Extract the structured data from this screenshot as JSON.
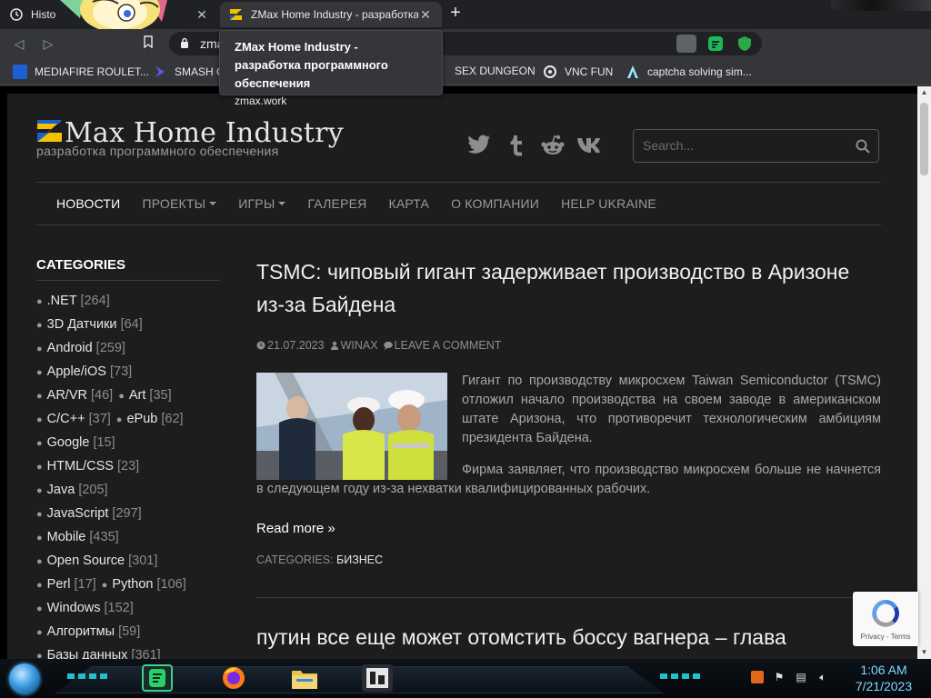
{
  "browser": {
    "tabs": [
      {
        "label": "Histo",
        "active": false
      },
      {
        "label": "ZMax Home Industry - разработка",
        "active": true
      }
    ],
    "address": {
      "value": "zma"
    },
    "bookmarks": [
      {
        "label": "MEDIAFIRE ROULET..."
      },
      {
        "label": "SMASH G"
      },
      {
        "label": "SEX DUNGEON"
      },
      {
        "label": "VNC FUN"
      },
      {
        "label": "captcha solving sim..."
      }
    ],
    "tooltip": {
      "title": "ZMax Home Industry - разработка программного обеспечения",
      "url": "zmax.work"
    }
  },
  "site": {
    "logo_title": "Max Home Industry",
    "logo_subtitle": "разработка программного обеспечения",
    "search_placeholder": "Search...",
    "nav": [
      {
        "label": "Новости",
        "active": true,
        "dropdown": false
      },
      {
        "label": "Проекты",
        "active": false,
        "dropdown": true
      },
      {
        "label": "Игры",
        "active": false,
        "dropdown": true
      },
      {
        "label": "Галерея",
        "active": false,
        "dropdown": false
      },
      {
        "label": "Карта",
        "active": false,
        "dropdown": false
      },
      {
        "label": "О компании",
        "active": false,
        "dropdown": false
      },
      {
        "label": "Help Ukraine",
        "active": false,
        "dropdown": false
      }
    ],
    "social_icons": [
      "twitter-icon",
      "tumblr-icon",
      "reddit-icon",
      "vk-icon"
    ],
    "categories_heading": "CATEGORIES",
    "categories": [
      [
        {
          "name": ".NET",
          "count": "[264]"
        }
      ],
      [
        {
          "name": "3D Датчики",
          "count": "[64]"
        }
      ],
      [
        {
          "name": "Android",
          "count": "[259]"
        }
      ],
      [
        {
          "name": "Apple/iOS",
          "count": "[73]"
        }
      ],
      [
        {
          "name": "AR/VR",
          "count": "[46]"
        },
        {
          "name": "Art",
          "count": "[35]"
        }
      ],
      [
        {
          "name": "C/C++",
          "count": "[37]"
        },
        {
          "name": "ePub",
          "count": "[62]"
        }
      ],
      [
        {
          "name": "Google",
          "count": "[15]"
        }
      ],
      [
        {
          "name": "HTML/CSS",
          "count": "[23]"
        }
      ],
      [
        {
          "name": "Java",
          "count": "[205]"
        }
      ],
      [
        {
          "name": "JavaScript",
          "count": "[297]"
        }
      ],
      [
        {
          "name": "Mobile",
          "count": "[435]"
        }
      ],
      [
        {
          "name": "Open Source",
          "count": "[301]"
        }
      ],
      [
        {
          "name": "Perl",
          "count": "[17]"
        },
        {
          "name": "Python",
          "count": "[106]"
        }
      ],
      [
        {
          "name": "Windows",
          "count": "[152]"
        }
      ],
      [
        {
          "name": "Алгоритмы",
          "count": "[59]"
        }
      ],
      [
        {
          "name": "Базы данных",
          "count": "[361]"
        }
      ]
    ],
    "article": {
      "title": "TSMC: чиповый гигант задерживает производство в Аризоне из-за Байдена",
      "date": "21.07.2023",
      "author": "WINAX",
      "comment_link": "LEAVE A COMMENT",
      "paragraph1": "Гигант по производству микросхем Taiwan Semiconductor (TSMC) отложил начало производства на своем заводе в американском штате Аризона, что противоречит технологическим амбициям президента Байдена.",
      "paragraph2": "Фирма заявляет, что производство микросхем больше не начнется в следующем году из-за нехватки квалифицированных рабочих.",
      "read_more": "Read more »",
      "categories_label": "CATEGORIES:",
      "category": "БИЗНЕС"
    },
    "next_article_title": "путин все еще может отомстить боссу вагнера – глава",
    "recaptcha_text": "Privacy - Terms"
  },
  "taskbar": {
    "time": "1:06 AM",
    "date": "7/21/2023"
  },
  "colors": {
    "page_bg": "#1d1d1d",
    "accent_cyan": "#7fd9ff",
    "logo_blue": "#1a5fd0",
    "logo_yellow": "#f2c200"
  }
}
